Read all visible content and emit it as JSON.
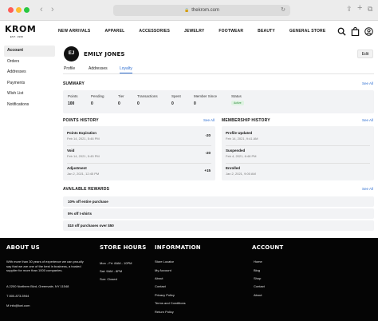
{
  "browser": {
    "url": "thekrom.com",
    "back_glyph": "‹",
    "forward_glyph": "›",
    "lock_glyph": "🔒",
    "reload_glyph": "↻",
    "share_glyph": "⇪",
    "new_tab_glyph": "+",
    "tabs_glyph": "⧉"
  },
  "header": {
    "logo": "KROM",
    "logo_sub": "EST. 1995",
    "nav": [
      "NEW ARRIVALS",
      "APPAREL",
      "ACCESSORIES",
      "JEWELRY",
      "FOOTWEAR",
      "BEAUTY",
      "GENERAL STORE"
    ],
    "icons": [
      "search-icon",
      "bag-icon",
      "user-icon"
    ]
  },
  "sidebar": {
    "items": [
      "Account",
      "Orders",
      "Addresses",
      "Payments",
      "Wish List",
      "Notifications"
    ]
  },
  "profile": {
    "initials": "EJ",
    "name": "EMILY JONES",
    "edit_label": "Edit",
    "tabs": [
      "Profile",
      "Addresses",
      "Loyalty"
    ],
    "active_tab": "Loyalty"
  },
  "summary": {
    "title": "SUMMARY",
    "see_all": "See All",
    "columns": [
      {
        "label": "Points",
        "value": "100"
      },
      {
        "label": "Pending",
        "value": "0"
      },
      {
        "label": "Tier",
        "value": "0"
      },
      {
        "label": "Transactions",
        "value": "0"
      },
      {
        "label": "Spent",
        "value": "0"
      },
      {
        "label": "Member Since",
        "value": "0"
      },
      {
        "label": "Status",
        "value": "Active"
      }
    ]
  },
  "points_history": {
    "title": "POINTS HISTORY",
    "see_all": "See All",
    "items": [
      {
        "title": "Points Expiration",
        "date": "Feb 14, 2021, 5:46 PM",
        "amount": "-20"
      },
      {
        "title": "Void",
        "date": "Feb 14, 2021, 5:45 PM",
        "amount": "-20"
      },
      {
        "title": "Adjustment",
        "date": "Jan 2, 2021, 12:45 PM",
        "amount": "+15"
      }
    ]
  },
  "membership_history": {
    "title": "MEMBERSHIP HISTORY",
    "see_all": "See All",
    "items": [
      {
        "title": "Profile Updated",
        "date": "Feb 14, 2021, 9:41 AM"
      },
      {
        "title": "Suspended",
        "date": "Feb 4, 2021, 6:48 PM"
      },
      {
        "title": "Enrolled",
        "date": "Jan 2, 2021, 9:00 AM"
      }
    ]
  },
  "rewards": {
    "title": "AVAILABLE REWARDS",
    "see_all": "See All",
    "items": [
      "10% off entire purchase",
      "5% off t-shirts",
      "$10 off purchases over $50"
    ]
  },
  "footer": {
    "about": {
      "title": "ABOUT US",
      "text": "With more than 30 years of experience we can proudly say that we are one of the best in business, a trusted supplier for more than 1000 companies.",
      "address": "A 2200 Northern Blvd, Greenvale, NY 11548",
      "phone": "T 800-873-5944",
      "email": "M info@kwi.com"
    },
    "hours": {
      "title": "STORE HOURS",
      "lines": [
        "Mon - Fri: 8AM - 10PM",
        "Sat: 9AM - 8PM",
        "Sun: Closed"
      ]
    },
    "information": {
      "title": "INFORMATION",
      "links": [
        "Store Locator",
        "My Account",
        "About",
        "Contact",
        "Privacy Policy",
        "Terms and Conditions",
        "Return Policy"
      ]
    },
    "account": {
      "title": "ACCOUNT",
      "links": [
        "Home",
        "Blog",
        "Shop",
        "Contact",
        "About"
      ]
    }
  },
  "colors": {
    "accent": "#2f6fd1",
    "footer_bg": "#050505",
    "panel_bg": "#f2f3f5",
    "status_green": "#2e8b3d"
  }
}
